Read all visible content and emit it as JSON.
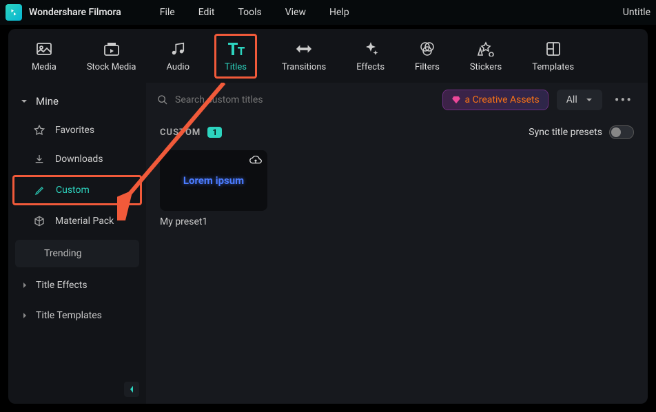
{
  "app": {
    "title": "Wondershare Filmora",
    "doc": "Untitle"
  },
  "menu": [
    "File",
    "Edit",
    "Tools",
    "View",
    "Help"
  ],
  "toolbar": [
    {
      "label": "Media"
    },
    {
      "label": "Stock Media"
    },
    {
      "label": "Audio"
    },
    {
      "label": "Titles",
      "active": true
    },
    {
      "label": "Transitions"
    },
    {
      "label": "Effects"
    },
    {
      "label": "Filters"
    },
    {
      "label": "Stickers"
    },
    {
      "label": "Templates"
    }
  ],
  "sidebar": {
    "header": "Mine",
    "items": [
      {
        "label": "Favorites",
        "icon": "star"
      },
      {
        "label": "Downloads",
        "icon": "download"
      },
      {
        "label": "Custom",
        "icon": "pencil",
        "active": true
      },
      {
        "label": "Material Pack",
        "icon": "cube"
      }
    ],
    "trending": "Trending",
    "sections": [
      "Title Effects",
      "Title Templates"
    ]
  },
  "search": {
    "placeholder": "Search custom titles"
  },
  "actions": {
    "creative_assets": "a Creative Assets",
    "filter_dropdown": "All",
    "section_title": "CUSTOM",
    "count": "1",
    "sync_label": "Sync title presets"
  },
  "presets": [
    {
      "name": "My preset1",
      "sample": "Lorem ipsum"
    }
  ]
}
